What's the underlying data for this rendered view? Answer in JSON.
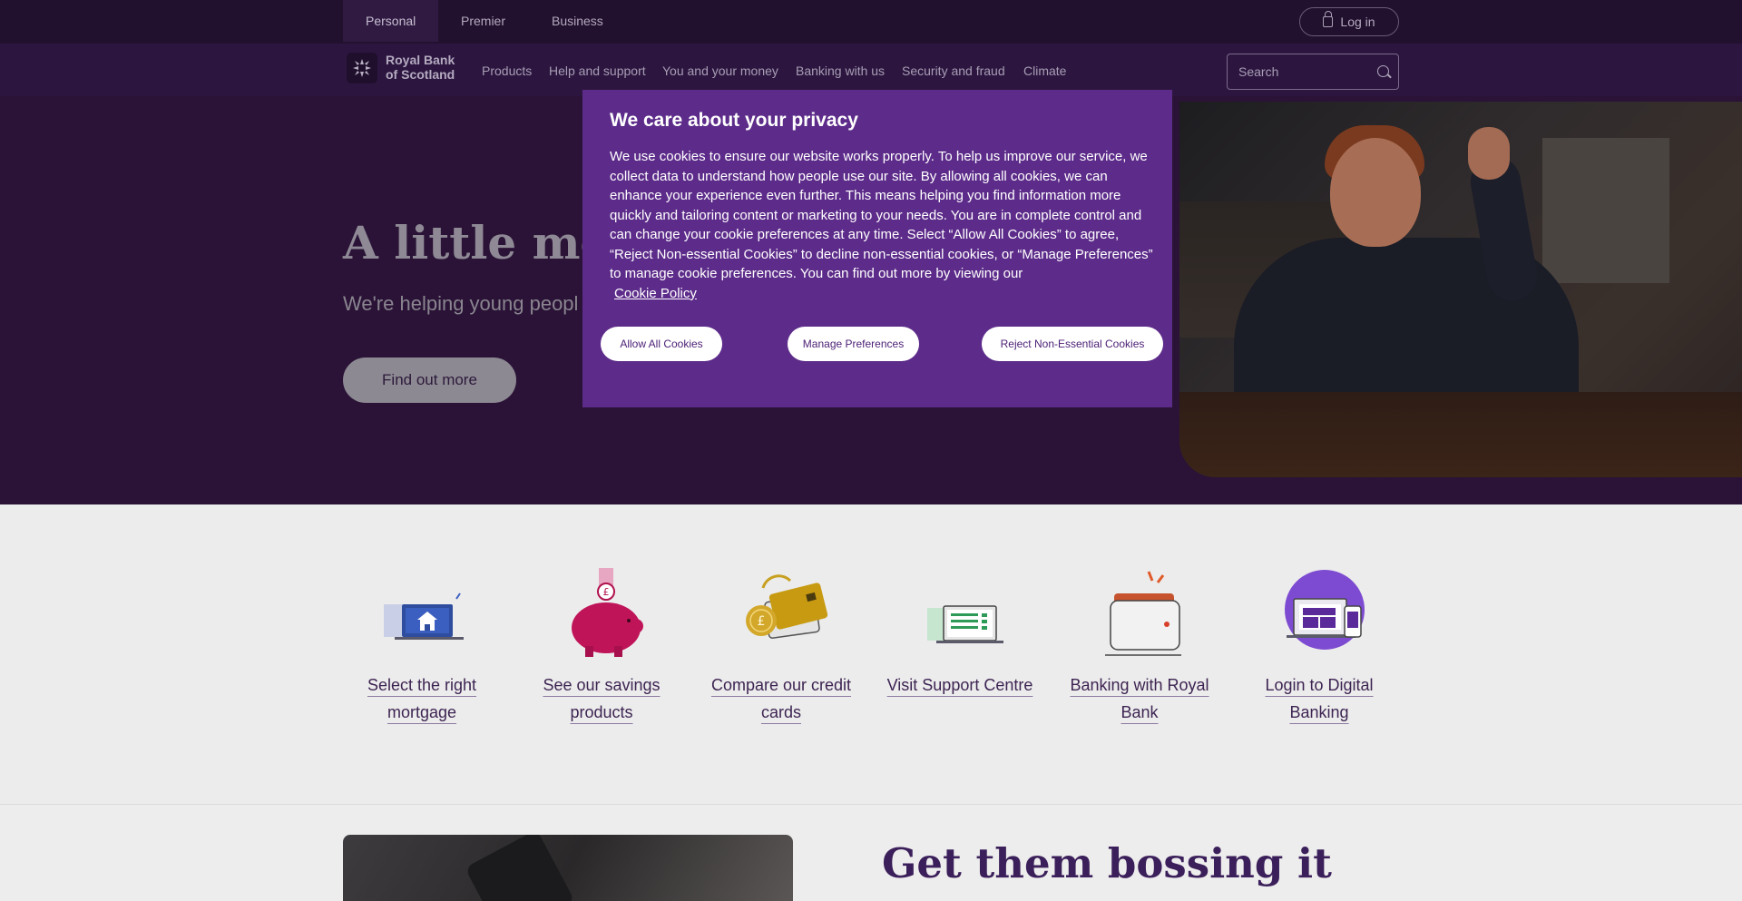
{
  "topbar": {
    "tabs": [
      {
        "label": "Personal",
        "active": true
      },
      {
        "label": "Premier",
        "active": false
      },
      {
        "label": "Business",
        "active": false
      }
    ],
    "login_label": "Log in"
  },
  "nav": {
    "logo_line1": "Royal Bank",
    "logo_line2": "of Scotland",
    "items": [
      {
        "label": "Products"
      },
      {
        "label": "Help and support"
      },
      {
        "label": "You and your money"
      },
      {
        "label": "Banking with us"
      },
      {
        "label": "Security and fraud"
      },
      {
        "label": "Climate"
      }
    ],
    "search_placeholder": "Search"
  },
  "hero": {
    "title": "A little mor",
    "subtitle": "We're helping young peopl",
    "cta_label": "Find out more"
  },
  "cookie": {
    "title": "We care about your privacy",
    "body": "We use cookies to ensure our website works properly. To help us improve our service, we collect data to understand how people use our site. By allowing all cookies, we can enhance your experience even further. This means helping you find information more quickly and tailoring content or marketing to your needs. You are in complete control and can change your cookie preferences at any time. Select “Allow All Cookies” to agree, “Reject Non-essential Cookies” to decline non-essential cookies, or “Manage Preferences” to manage cookie preferences. You can find out more by viewing our",
    "policy_link": "Cookie Policy",
    "allow_label": "Allow All Cookies",
    "manage_label": "Manage Preferences",
    "reject_label": "Reject Non-Essential Cookies"
  },
  "quicklinks": [
    {
      "label": "Select the right mortgage",
      "icon": "laptop-house-icon"
    },
    {
      "label": "See our savings products",
      "icon": "piggy-bank-icon"
    },
    {
      "label": "Compare our credit cards",
      "icon": "credit-cards-icon"
    },
    {
      "label": "Visit Support Centre",
      "icon": "laptop-support-icon"
    },
    {
      "label": "Banking with Royal Bank",
      "icon": "wallet-icon"
    },
    {
      "label": "Login to Digital Banking",
      "icon": "devices-icon"
    }
  ],
  "bottom": {
    "title": "Get them bossing it"
  },
  "colors": {
    "brand_purple": "#5d2c8a",
    "topbar": "#22102f",
    "hero_bg": "#2a1336",
    "link_purple": "#3d2452"
  }
}
